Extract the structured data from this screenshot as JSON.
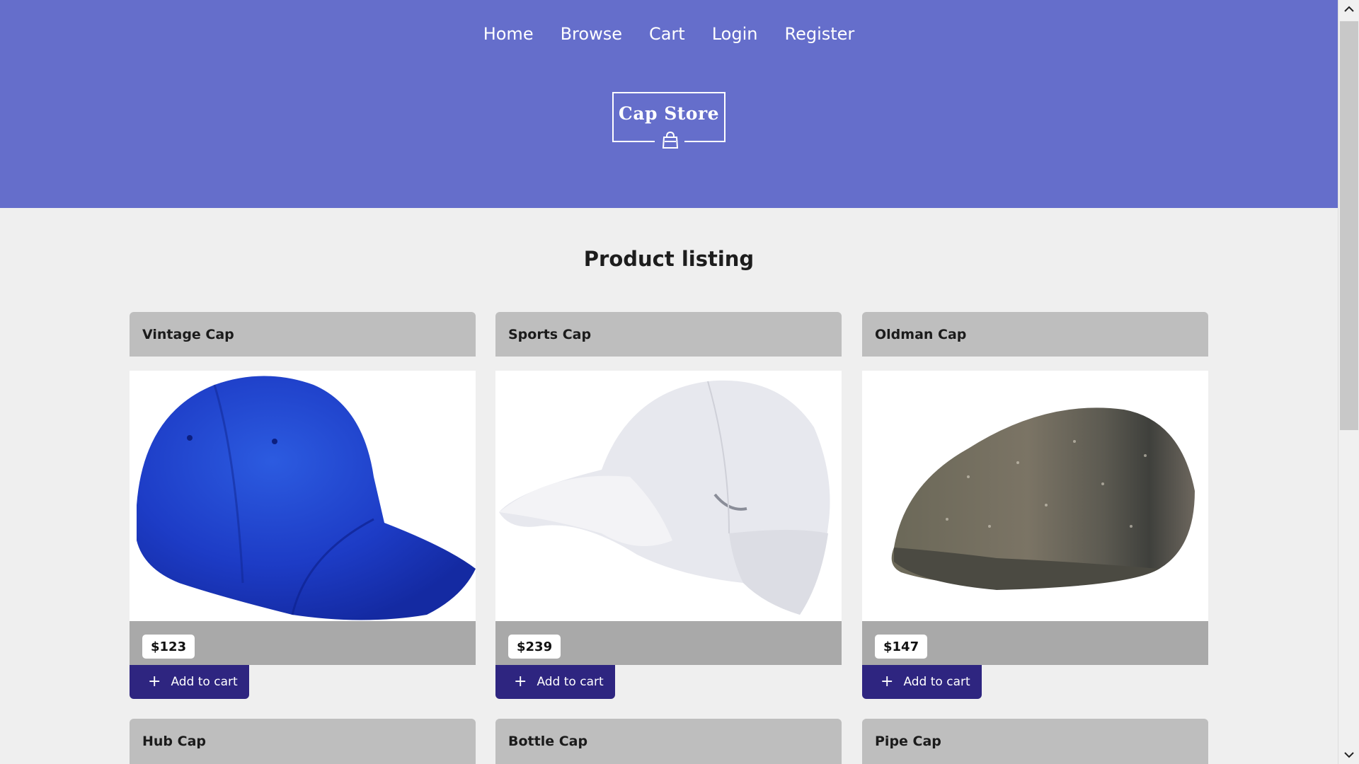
{
  "nav": {
    "items": [
      "Home",
      "Browse",
      "Cart",
      "Login",
      "Register"
    ]
  },
  "logo": {
    "title": "Cap Store",
    "icon": "shopping-bag-icon"
  },
  "main": {
    "title": "Product listing",
    "add_label": "Add to cart",
    "products": [
      {
        "name": "Vintage Cap",
        "price": "$123"
      },
      {
        "name": "Sports Cap",
        "price": "$239"
      },
      {
        "name": "Oldman Cap",
        "price": "$147"
      },
      {
        "name": "Hub Cap"
      },
      {
        "name": "Bottle Cap"
      },
      {
        "name": "Pipe Cap"
      }
    ]
  },
  "colors": {
    "header_bg": "#656ecb",
    "button_bg": "#2e2580",
    "page_bg": "#efefef"
  }
}
